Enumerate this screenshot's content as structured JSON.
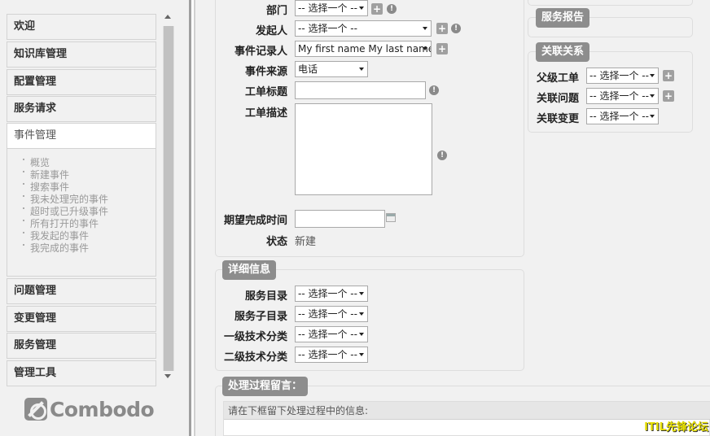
{
  "sidebar": {
    "menu": [
      {
        "label": "欢迎"
      },
      {
        "label": "知识库管理"
      },
      {
        "label": "配置管理"
      },
      {
        "label": "服务请求"
      },
      {
        "label": "事件管理"
      },
      {
        "label": "问题管理"
      },
      {
        "label": "变更管理"
      },
      {
        "label": "服务管理"
      },
      {
        "label": "管理工具"
      }
    ],
    "submenu": [
      "概览",
      "新建事件",
      "搜索事件",
      "我未处理完的事件",
      "超时或已升级事件",
      "所有打开的事件",
      "我发起的事件",
      "我完成的事件"
    ],
    "logo_text": "Combodo"
  },
  "general": {
    "department_label": "部门",
    "department_value": "-- 选择一个 --",
    "caller_label": "发起人",
    "caller_value": "-- 选择一个 --",
    "recorder_label": "事件记录人",
    "recorder_value": "My first name My last name",
    "origin_label": "事件来源",
    "origin_value": "电话",
    "title_label": "工单标题",
    "title_value": "",
    "description_label": "工单描述",
    "description_value": "",
    "deadline_label": "期望完成时间",
    "deadline_value": "",
    "status_label": "状态",
    "status_value": "新建"
  },
  "details": {
    "legend": "详细信息",
    "service_label": "服务目录",
    "service_value": "-- 选择一个 --",
    "subservice_label": "服务子目录",
    "subservice_value": "-- 选择一个 --",
    "tech1_label": "一级技术分类",
    "tech1_value": "-- 选择一个 --",
    "tech2_label": "二级技术分类",
    "tech2_value": "-- 选择一个 --"
  },
  "log": {
    "legend": "处理过程留言：",
    "hint": "请在下框留下处理过程中的信息:"
  },
  "right": {
    "report_legend": "服务报告",
    "relations_legend": "关联关系",
    "parent_label": "父级工单",
    "parent_value": "-- 选择一个 --",
    "problem_label": "关联问题",
    "problem_value": "-- 选择一个 --",
    "change_label": "关联变更",
    "change_value": "-- 选择一个 --"
  },
  "watermark": "ITIL先锋论坛",
  "icons": {
    "plus": "+",
    "info": "!"
  }
}
